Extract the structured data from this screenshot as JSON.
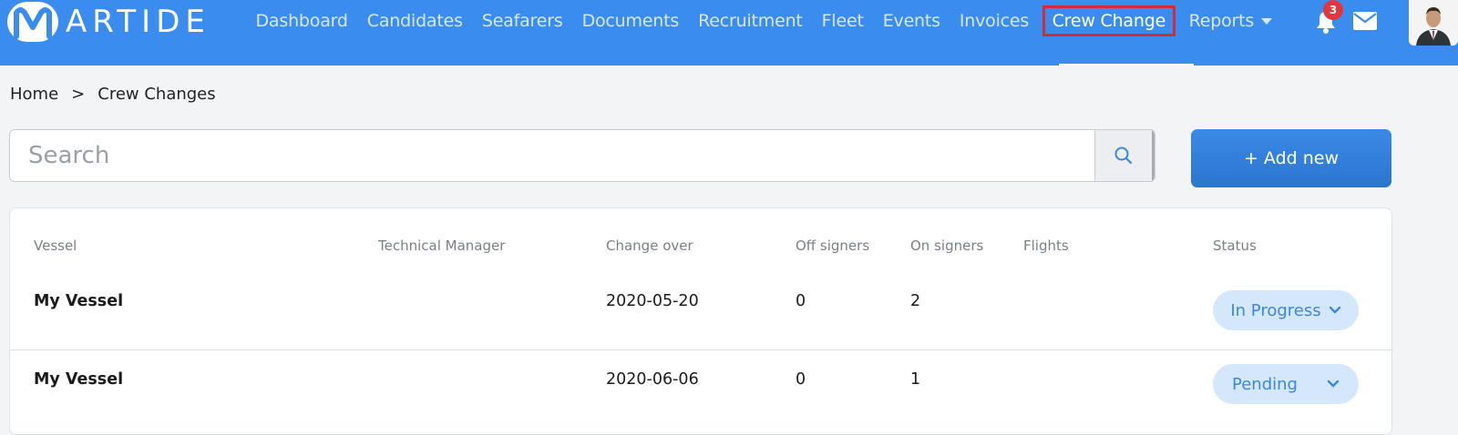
{
  "brand": {
    "logo_letter": "M",
    "logo_text": "ARTIDE"
  },
  "nav": {
    "items": [
      {
        "label": "Dashboard"
      },
      {
        "label": "Candidates"
      },
      {
        "label": "Seafarers"
      },
      {
        "label": "Documents"
      },
      {
        "label": "Recruitment"
      },
      {
        "label": "Fleet"
      },
      {
        "label": "Events"
      },
      {
        "label": "Invoices"
      },
      {
        "label": "Crew Change",
        "active": true
      },
      {
        "label": "Reports",
        "dropdown": true
      }
    ],
    "notifications_count": "3"
  },
  "breadcrumb": {
    "home": "Home",
    "separator": ">",
    "current": "Crew Changes"
  },
  "search": {
    "placeholder": "Search",
    "value": ""
  },
  "add_button": {
    "label": "+ Add new"
  },
  "table": {
    "columns": [
      "Vessel",
      "Technical Manager",
      "Change over",
      "Off signers",
      "On signers",
      "Flights",
      "Status"
    ],
    "rows": [
      {
        "vessel": "My Vessel",
        "technical_manager": "",
        "change_over": "2020-05-20",
        "off_signers": "0",
        "on_signers": "2",
        "flights": "",
        "status": "In Progress"
      },
      {
        "vessel": "My Vessel",
        "technical_manager": "",
        "change_over": "2020-06-06",
        "off_signers": "0",
        "on_signers": "1",
        "flights": "",
        "status": "Pending"
      }
    ]
  },
  "colors": {
    "navbar": "#3a8dee",
    "active_highlight_border": "#d42a3a",
    "badge": "#e2353d",
    "status_pill_bg": "#d5e7fb",
    "status_pill_text": "#3a87dc",
    "primary_button": "#2f7cd9"
  }
}
